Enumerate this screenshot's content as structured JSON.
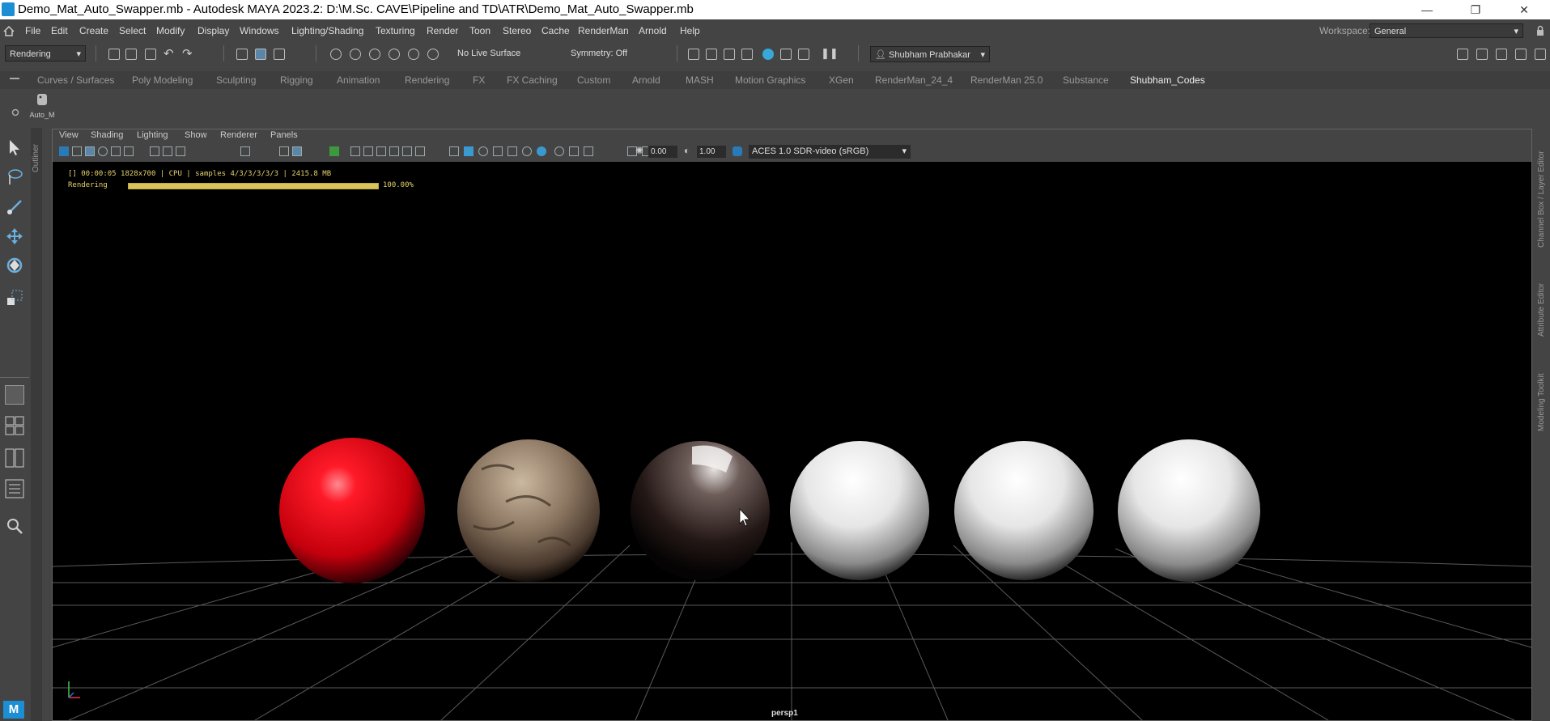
{
  "window": {
    "title": "Demo_Mat_Auto_Swapper.mb - Autodesk MAYA 2023.2: D:\\M.Sc. CAVE\\Pipeline and TD\\ATR\\Demo_Mat_Auto_Swapper.mb",
    "minimize_glyph": "—",
    "restore_glyph": "❐",
    "close_glyph": "✕"
  },
  "menu": {
    "items": [
      "File",
      "Edit",
      "Create",
      "Select",
      "Modify",
      "Display",
      "Windows",
      "Lighting/Shading",
      "Texturing",
      "Render",
      "Toon",
      "Stereo",
      "Cache",
      "RenderMan",
      "Arnold",
      "Help"
    ],
    "workspace_label": "Workspace:",
    "workspace_value": "General"
  },
  "toolbar": {
    "menuset": "Rendering",
    "live_surface": "No Live Surface",
    "symmetry": "Symmetry: Off",
    "user": "Shubham Prabhakar"
  },
  "shelf": {
    "tabs": [
      "Curves / Surfaces",
      "Poly Modeling",
      "Sculpting",
      "Rigging",
      "Animation",
      "Rendering",
      "FX",
      "FX Caching",
      "Custom",
      "Arnold",
      "MASH",
      "Motion Graphics",
      "XGen",
      "RenderMan_24_4",
      "RenderMan 25.0",
      "Substance",
      "Shubham_Codes"
    ],
    "active_tab": "Shubham_Codes",
    "tool_label": "Auto_M"
  },
  "side_labels": {
    "outliner": "Outliner",
    "right": [
      "Channel Box / Layer Editor",
      "Attribute Editor",
      "Modeling Toolkit"
    ]
  },
  "panel": {
    "menu": [
      "View",
      "Shading",
      "Lighting",
      "Show",
      "Renderer",
      "Panels"
    ],
    "field_a": "0.00",
    "field_b": "1.00",
    "color_space": "ACES 1.0 SDR-video (sRGB)",
    "camera": "persp1"
  },
  "render_hud": {
    "info": "[] 00:00:05 1828x700 | CPU | samples 4/3/3/3/3/3 | 2415.8 MB",
    "status_label": "Rendering",
    "progress": 1.0,
    "progress_text": "100.00%"
  },
  "spheres": [
    {
      "name": "red-material-sphere",
      "base": "#ff2030",
      "dark": "#4a0008"
    },
    {
      "name": "rock-material-sphere",
      "base": "#a08c78",
      "dark": "#2a211b"
    },
    {
      "name": "dark-metal-material-sphere",
      "base": "#7a6a66",
      "dark": "#0a0606"
    },
    {
      "name": "white-material-sphere-1",
      "base": "#f2f2f2",
      "dark": "#1a1a1a"
    },
    {
      "name": "white-material-sphere-2",
      "base": "#f2f2f2",
      "dark": "#1a1a1a"
    },
    {
      "name": "white-material-sphere-3",
      "base": "#efefef",
      "dark": "#1a1a1a"
    }
  ],
  "app_badge": "M"
}
